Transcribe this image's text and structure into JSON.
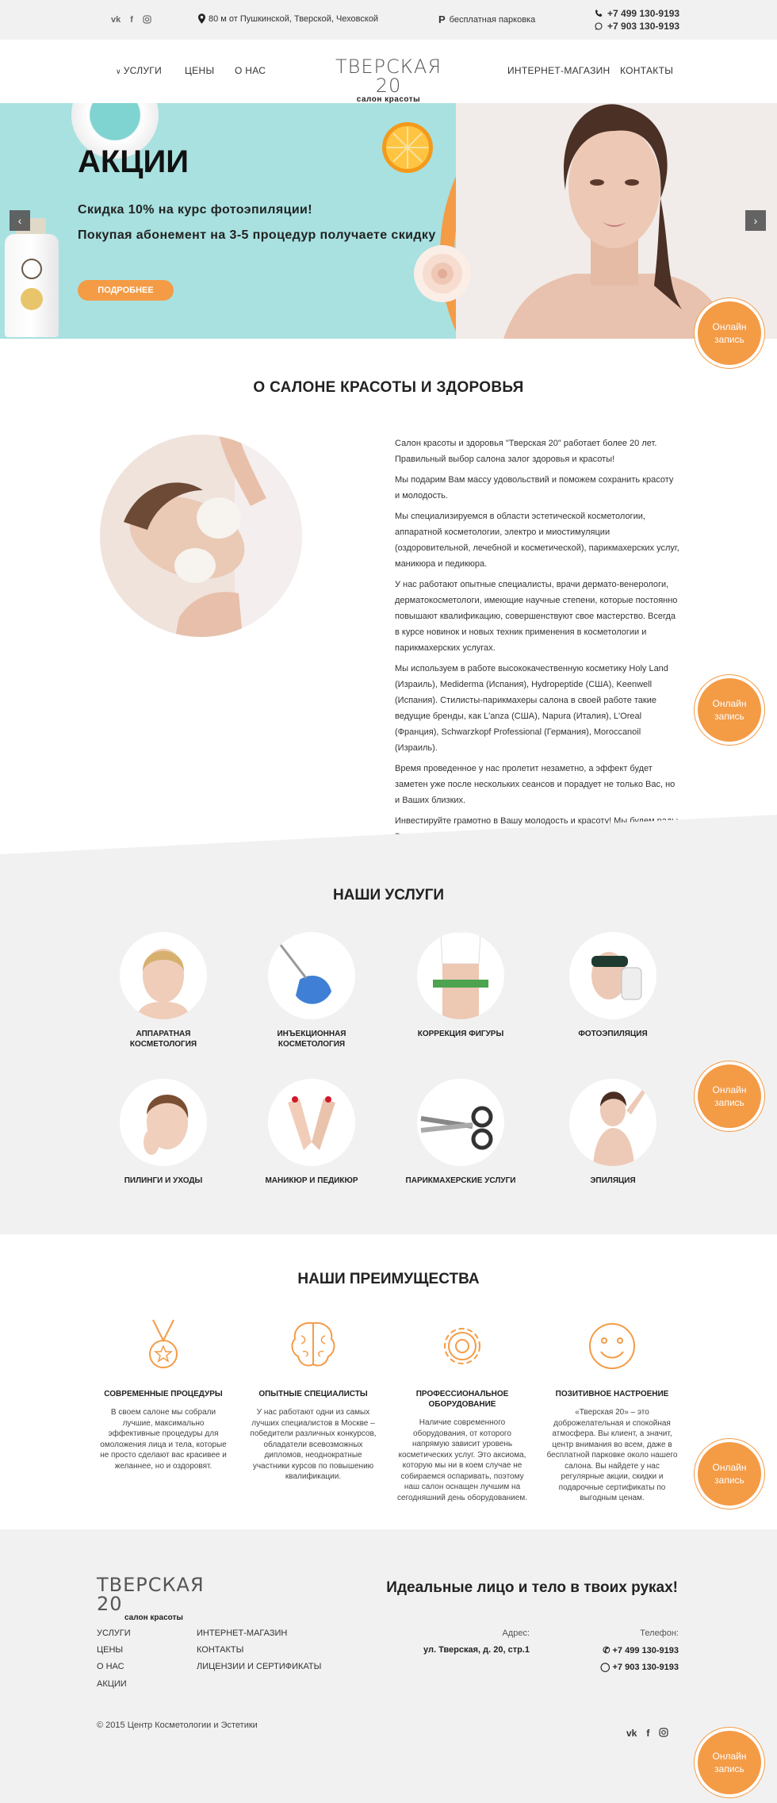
{
  "topbar": {
    "social_icons": [
      "vk-icon",
      "facebook-icon",
      "instagram-icon"
    ],
    "address": "80 м от Пушкинской, Тверской, Чеховской",
    "parking": "бесплатная парковка",
    "phone1": "+7 499 130-9193",
    "phone2": "+7 903 130-9193"
  },
  "nav": {
    "services": "Услуги",
    "prices": "Цены",
    "about": "О нас",
    "shop": "Интернет-магазин",
    "contacts": "Контакты",
    "logo_title": "ТВЕРСКАЯ 20",
    "logo_sub": "салон красоты"
  },
  "hero": {
    "title": "АКЦИИ",
    "line1": "Скидка 10% на курс фотоэпиляции!",
    "line2": "Покупая абонемент на 3-5 процедур получаете скидку",
    "button": "Подробнее",
    "prev": "‹",
    "next": "›"
  },
  "online_button": "Онлайн запись",
  "about": {
    "title": "О САЛОНЕ КРАСОТЫ И ЗДОРОВЬЯ",
    "paragraphs": [
      "Салон красоты и здоровья \"Тверская 20\" работает более 20 лет. Правильный выбор салона залог здоровья и красоты!",
      "Мы подарим Вам массу удовольствий и поможем сохранить красоту и молодость.",
      "Мы специализируемся в области эстетической косметологии, аппаратной косметологии, электро и миостимуляции (оздоровительной, лечебной и косметической), парикмахерских услуг, маникюра и педикюра.",
      "У нас работают опытные специалисты, врачи дермато-венерологи, дерматокосметологи, имеющие научные степени, которые постоянно повышают квалификацию, совершенствуют свое мастерство. Всегда в курсе новинок и новых техник применения в косметологии и парикмахерских услугах.",
      "Мы используем в работе высококачественную косметику Holy Land (Израиль), Mediderma (Испания), Hydropeptide (США), Keenwell (Испания). Стилисты-парикмахеры салона в своей работе такие ведущие бренды, как L'anza (США), Napura (Италия), L'Oreal (Франция), Schwarzkopf Professional (Германия), Moroccanoil (Израиль).",
      "Время проведенное у нас пролетит незаметно, а эффект будет заметен уже после нескольких сеансов и порадует не только Вас, но и Ваших близких.",
      "Инвестируйте грамотно в Вашу молодость и красоту! Мы будем рады Вас видеть!"
    ]
  },
  "services": {
    "title": "НАШИ УСЛУГИ",
    "items": [
      {
        "label": "Аппаратная косметология"
      },
      {
        "label": "Инъекционная косметология"
      },
      {
        "label": "Коррекция фигуры"
      },
      {
        "label": "Фотоэпиляция"
      },
      {
        "label": "Пилинги и уходы"
      },
      {
        "label": "Маникюр и педикюр"
      },
      {
        "label": "Парикмахерские услуги"
      },
      {
        "label": "Эпиляция"
      }
    ]
  },
  "advantages": {
    "title": "НАШИ ПРЕИМУЩЕСТВА",
    "items": [
      {
        "title": "Современные процедуры",
        "icon": "medal-icon",
        "text": "В своем салоне мы собрали лучшие, максимально эффективные процедуры для омоложения лица и тела, которые не просто сделают вас красивее и желаннее, но и оздоровят."
      },
      {
        "title": "Опытные специалисты",
        "icon": "brain-icon",
        "text": "У нас работают одни из самых лучших специалистов в Москве – победители различных конкурсов, обладатели всевозможных дипломов, неоднократные участники курсов по повышению квалификации."
      },
      {
        "title": "Профессиональное оборудование",
        "icon": "gear-icon",
        "text": "Наличие современного оборудования, от которого напрямую зависит уровень косметических услуг. Это аксиома, которую мы ни в коем случае не собираемся оспаривать, поэтому наш салон оснащен лучшим на сегодняшний день оборудованием."
      },
      {
        "title": "Позитивное настроение",
        "icon": "smile-icon",
        "text": "«Тверская 20» – это доброжелательная и спокойная атмосфера. Вы клиент, а значит, центр внимания во всем, даже в бесплатной парковке около нашего салона. Вы найдете у нас регулярные акции, скидки и подарочные сертификаты по выгодным ценам."
      }
    ]
  },
  "footer": {
    "logo_title": "ТВЕРСКАЯ 20",
    "logo_sub": "салон красоты",
    "slogan": "Идеальные лицо и тело в твоих руках!",
    "menu1": [
      "Услуги",
      "Цены",
      "О нас",
      "Акции"
    ],
    "menu2": [
      "Интернет-магазин",
      "Контакты",
      "Лицензии и сертификаты"
    ],
    "address_label": "Адрес:",
    "address": "ул. Тверская, д. 20, стр.1",
    "phone_label": "Телефон:",
    "phone1": "+7 499 130-9193",
    "phone2": "+7 903 130-9193",
    "copyright": "© 2015 Центр Косметологии и Эстетики"
  },
  "colors": {
    "accent": "#f49b46",
    "hero_bg": "#a8e1e0",
    "section_gray": "#f1f1f1"
  }
}
